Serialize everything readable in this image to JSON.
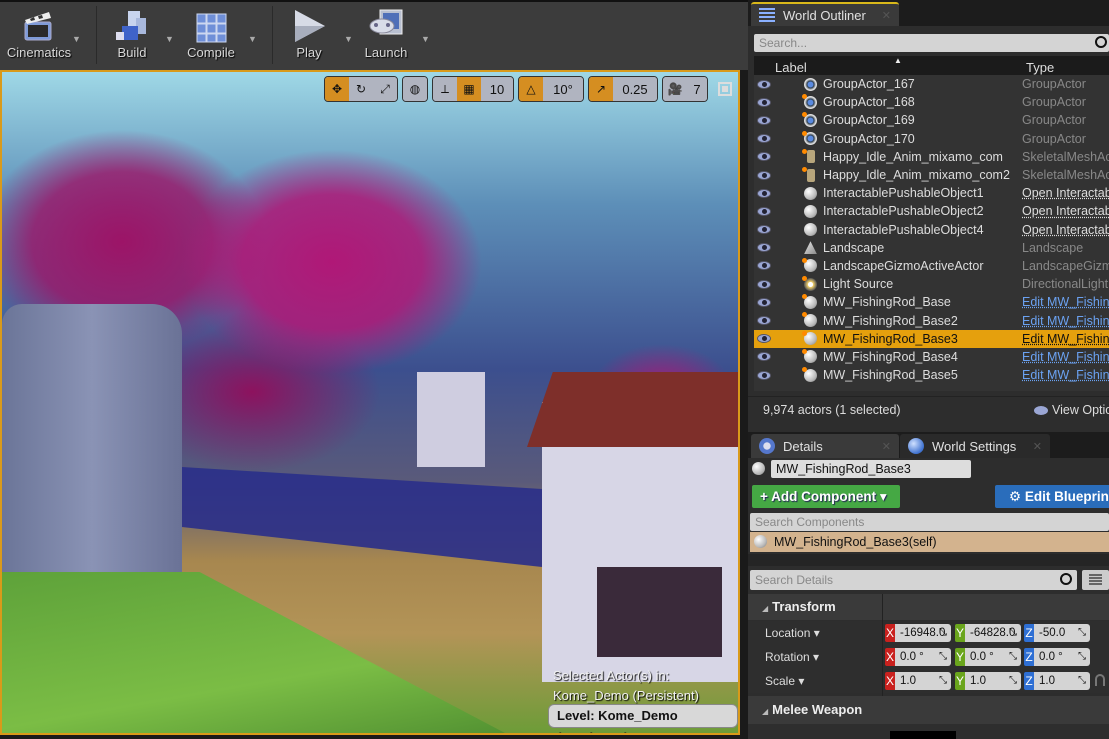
{
  "toolbar": {
    "buttons": [
      {
        "label": "Cinematics",
        "icon": "clapperboard-icon"
      },
      {
        "label": "Build",
        "icon": "build-blocks-icon"
      },
      {
        "label": "Compile",
        "icon": "cube-grid-icon"
      },
      {
        "label": "Play",
        "icon": "play-triangle-icon"
      },
      {
        "label": "Launch",
        "icon": "gamepad-monitor-icon"
      }
    ]
  },
  "viewport": {
    "tools": {
      "grid_snap_value": "10",
      "rotation_snap_value": "10°",
      "scale_snap_value": "0.25",
      "camera_speed_value": "7"
    },
    "selected_info_line1": "Selected Actor(s) in:",
    "selected_info_line2": "Kome_Demo (Persistent)",
    "level_label": "Level:  Kome_Demo (Persistent)"
  },
  "outliner": {
    "tab_label": "World Outliner",
    "search_placeholder": "Search...",
    "columns": {
      "label": "Label",
      "type": "Type"
    },
    "rows": [
      {
        "name": "GroupActor_167",
        "type": "GroupActor",
        "icon": "group",
        "dot": false,
        "link": "none",
        "selected": false
      },
      {
        "name": "GroupActor_168",
        "type": "GroupActor",
        "icon": "group",
        "dot": true,
        "link": "none",
        "selected": false
      },
      {
        "name": "GroupActor_169",
        "type": "GroupActor",
        "icon": "group",
        "dot": true,
        "link": "none",
        "selected": false
      },
      {
        "name": "GroupActor_170",
        "type": "GroupActor",
        "icon": "group",
        "dot": true,
        "link": "none",
        "selected": false
      },
      {
        "name": "Happy_Idle_Anim_mixamo_com",
        "type": "SkeletalMeshActor",
        "icon": "skel",
        "dot": true,
        "link": "none",
        "selected": false
      },
      {
        "name": "Happy_Idle_Anim_mixamo_com2",
        "type": "SkeletalMeshActor",
        "icon": "skel",
        "dot": true,
        "link": "none",
        "selected": false
      },
      {
        "name": "InteractablePushableObject1",
        "type": "Open InteractablePushableObject",
        "icon": "ball",
        "dot": false,
        "link": "white",
        "selected": false
      },
      {
        "name": "InteractablePushableObject2",
        "type": "Open InteractablePushableObject",
        "icon": "ball",
        "dot": false,
        "link": "white",
        "selected": false
      },
      {
        "name": "InteractablePushableObject4",
        "type": "Open InteractablePushableObject",
        "icon": "ball",
        "dot": false,
        "link": "white",
        "selected": false
      },
      {
        "name": "Landscape",
        "type": "Landscape",
        "icon": "land",
        "dot": false,
        "link": "none",
        "selected": false
      },
      {
        "name": "LandscapeGizmoActiveActor",
        "type": "LandscapeGizmoActiveActor",
        "icon": "ball",
        "dot": true,
        "link": "none",
        "selected": false
      },
      {
        "name": "Light Source",
        "type": "DirectionalLight",
        "icon": "light",
        "dot": true,
        "link": "none",
        "selected": false
      },
      {
        "name": "MW_FishingRod_Base",
        "type": "Edit MW_FishingRod_Base",
        "icon": "ball",
        "dot": true,
        "link": "blue",
        "selected": false
      },
      {
        "name": "MW_FishingRod_Base2",
        "type": "Edit MW_FishingRod_Base",
        "icon": "ball",
        "dot": true,
        "link": "blue",
        "selected": false
      },
      {
        "name": "MW_FishingRod_Base3",
        "type": "Edit MW_FishingRod_Base",
        "icon": "ball",
        "dot": true,
        "link": "blue",
        "selected": true
      },
      {
        "name": "MW_FishingRod_Base4",
        "type": "Edit MW_FishingRod_Base",
        "icon": "ball",
        "dot": true,
        "link": "blue",
        "selected": false
      },
      {
        "name": "MW_FishingRod_Base5",
        "type": "Edit MW_FishingRod_Base",
        "icon": "ball",
        "dot": true,
        "link": "blue",
        "selected": false
      }
    ],
    "actor_count": "9,974 actors (1 selected)",
    "view_options": "View Options"
  },
  "details": {
    "tab_label": "Details",
    "world_settings_tab_label": "World Settings",
    "actor_name": "MW_FishingRod_Base3",
    "add_component_label": "+ Add Component ▾",
    "edit_blueprint_label": "⚙ Edit Blueprint",
    "search_components_placeholder": "Search Components",
    "self_component": "MW_FishingRod_Base3(self)",
    "search_details_placeholder": "Search Details",
    "transform_section": "Transform",
    "location": {
      "label": "Location ▾",
      "x": "-16948.0",
      "y": "-64828.0",
      "z": "-50.0"
    },
    "rotation": {
      "label": "Rotation ▾",
      "x": "0.0 °",
      "y": "0.0 °",
      "z": "0.0 °"
    },
    "scale": {
      "label": "Scale ▾",
      "x": "1.0",
      "y": "1.0",
      "z": "1.0"
    },
    "melee_section": "Melee Weapon",
    "axis_labels": {
      "x": "X",
      "y": "Y",
      "z": "Z"
    }
  },
  "colors": {
    "selection": "#e5a00d",
    "viewport_border": "#d99a1a",
    "add_component": "#45a844",
    "edit_blueprint": "#2a6dbb",
    "axis_x": "#c9211e",
    "axis_y": "#6aa51c",
    "axis_z": "#2e6fd4"
  }
}
